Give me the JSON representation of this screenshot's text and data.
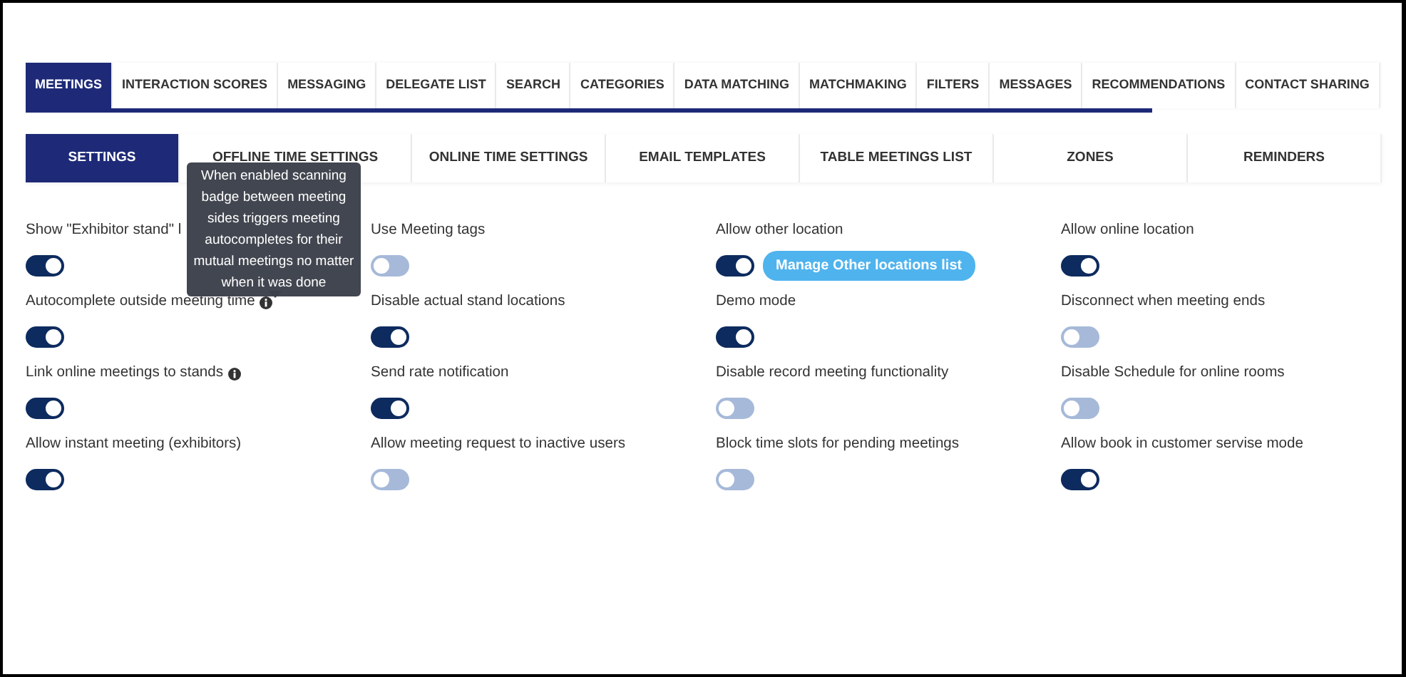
{
  "main_tabs": [
    {
      "label": "MEETINGS",
      "selected": true
    },
    {
      "label": "INTERACTION SCORES",
      "selected": false
    },
    {
      "label": "MESSAGING",
      "selected": false
    },
    {
      "label": "DELEGATE LIST",
      "selected": false
    },
    {
      "label": "SEARCH",
      "selected": false
    },
    {
      "label": "CATEGORIES",
      "selected": false
    },
    {
      "label": "DATA MATCHING",
      "selected": false
    },
    {
      "label": "MATCHMAKING",
      "selected": false
    },
    {
      "label": "FILTERS",
      "selected": false
    },
    {
      "label": "MESSAGES",
      "selected": false
    },
    {
      "label": "RECOMMENDATIONS",
      "selected": false
    },
    {
      "label": "CONTACT SHARING",
      "selected": false
    }
  ],
  "sub_tabs": [
    {
      "label": "SETTINGS",
      "selected": true
    },
    {
      "label": "OFFLINE TIME SETTINGS",
      "selected": false
    },
    {
      "label": "ONLINE TIME SETTINGS",
      "selected": false
    },
    {
      "label": "EMAIL TEMPLATES",
      "selected": false
    },
    {
      "label": "TABLE MEETINGS LIST",
      "selected": false
    },
    {
      "label": "ZONES",
      "selected": false
    },
    {
      "label": "REMINDERS",
      "selected": false
    }
  ],
  "settings": [
    {
      "label": "Show \"Exhibitor stand\" l",
      "on": true,
      "info": false
    },
    {
      "label": "Use Meeting tags",
      "on": false,
      "info": false
    },
    {
      "label": "Allow other location",
      "on": true,
      "info": false,
      "button": "Manage Other locations list"
    },
    {
      "label": "Allow online location",
      "on": true,
      "info": false
    },
    {
      "label": "Autocomplete outside meeting time",
      "on": true,
      "info": true
    },
    {
      "label": "Disable actual stand locations",
      "on": true,
      "info": false
    },
    {
      "label": "Demo mode",
      "on": true,
      "info": false
    },
    {
      "label": "Disconnect when meeting ends",
      "on": false,
      "info": false
    },
    {
      "label": "Link online meetings to stands",
      "on": true,
      "info": true
    },
    {
      "label": "Send rate notification",
      "on": true,
      "info": false
    },
    {
      "label": "Disable record meeting functionality",
      "on": false,
      "info": false
    },
    {
      "label": "Disable Schedule for online rooms",
      "on": false,
      "info": false
    },
    {
      "label": "Allow instant meeting (exhibitors)",
      "on": true,
      "info": false
    },
    {
      "label": "Allow meeting request to inactive users",
      "on": false,
      "info": false
    },
    {
      "label": "Block time slots for pending meetings",
      "on": false,
      "info": false
    },
    {
      "label": "Allow book in customer servise mode",
      "on": true,
      "info": false
    }
  ],
  "tooltip": {
    "text": "When enabled scanning badge between meeting sides triggers meeting autocompletes for their mutual meetings no matter when it was done"
  }
}
